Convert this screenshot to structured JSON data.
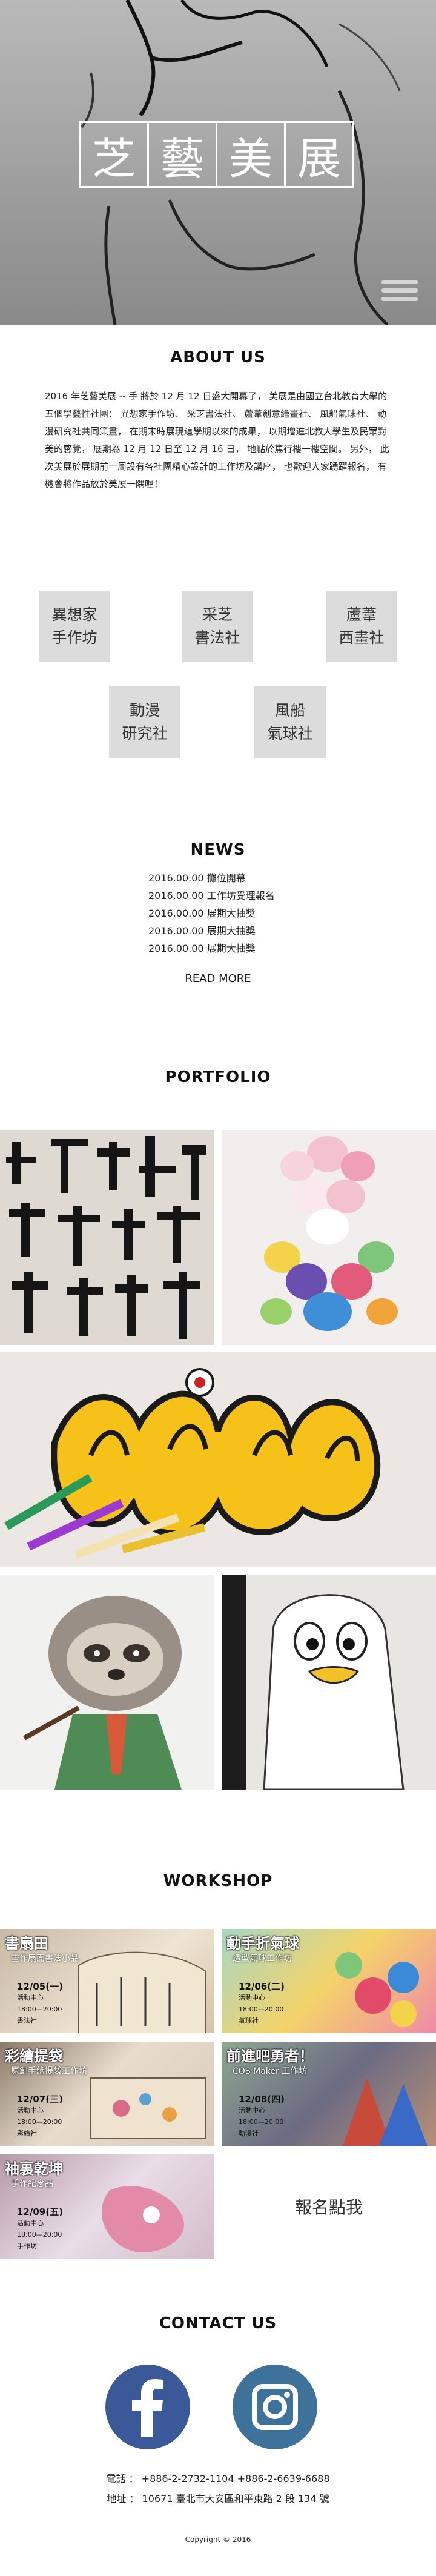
{
  "hero": {
    "title_chars": [
      "芝",
      "藝",
      "美",
      "展"
    ],
    "menu_icon": "hamburger-menu-icon"
  },
  "about": {
    "heading": "ABOUT US",
    "text": "2016 年芝藝美展 -- 手 將於 12 月 12 日盛大開幕了，  美展是由國立台北教育大學的五個學藝性社團：  異想家手作坊、  采芝書法社、  蘆葦創意繪畫社、  風船氣球社、  動漫研究社共同策畫，  在期末時展現這學期以來的成果，  以期增進北教大學生及民眾對美的感覺，  展期為 12 月 12 日至 12 月 16 日，  地點於篤行樓一樓空間。  另外，  此次美展於展期前一周設有各社團精心設計的工作坊及講座，  也歡迎大家踴躍報名，  有機會將作品放於美展一隅喔！"
  },
  "clubs": [
    {
      "line1": "異想家",
      "line2": "手作坊"
    },
    {
      "line1": "采芝",
      "line2": "書法社"
    },
    {
      "line1": "蘆葦",
      "line2": "西畫社"
    },
    {
      "line1": "動漫",
      "line2": "研究社"
    },
    {
      "line1": "風船",
      "line2": "氣球社"
    }
  ],
  "news": {
    "heading": "NEWS",
    "items": [
      "2016.00.00  攤位開幕",
      "2016.00.00  工作坊受理報名",
      "2016.00.00  展期大抽獎",
      "2016.00.00  展期大抽獎",
      "2016.00.00  展期大抽獎"
    ],
    "read_more": "READ MORE"
  },
  "portfolio": {
    "heading": "PORTFOLIO",
    "tiles": [
      "calligraphy",
      "balloon-sculpture",
      "graffiti-art",
      "sloth-painting",
      "penguin-cartoon"
    ]
  },
  "workshop": {
    "heading": "WORKSHOP",
    "items": [
      {
        "title": "書扇田",
        "subtitle": "畫作扇面書法小品",
        "date": "12/05(一)",
        "place": "活動中心",
        "time": "18:00—20:00",
        "club": "書法社"
      },
      {
        "title": "動手折氣球",
        "subtitle": "造型氣球工作坊",
        "date": "12/06(二)",
        "place": "活動中心",
        "time": "18:00—20:00",
        "club": "氣球社"
      },
      {
        "title": "彩繪提袋",
        "subtitle": "原創手繪提袋工作坊",
        "date": "12/07(三)",
        "place": "活動中心",
        "time": "18:00—20:00",
        "club": "彩繪社"
      },
      {
        "title": "前進吧勇者！",
        "subtitle": "COS Maker 工作坊",
        "date": "12/08(四)",
        "place": "活動中心",
        "time": "18:00—20:00",
        "club": "動漫社"
      },
      {
        "title": "袖裏乾坤",
        "subtitle": "手作紀念品",
        "date": "12/09(五)",
        "place": "活動中心",
        "time": "18:00—20:00",
        "club": "手作坊"
      }
    ],
    "signup": "報名點我"
  },
  "contact": {
    "heading": "CONTACT US",
    "phone": "電話 ： +886-2-2732-1104   +886-2-6639-6688",
    "address": "地址 ： 10671 臺北市大安區和平東路 2 段 134 號",
    "copyright": "Copyright © 2016",
    "facebook_color": "#3b5998",
    "instagram_color": "#3f729b"
  }
}
